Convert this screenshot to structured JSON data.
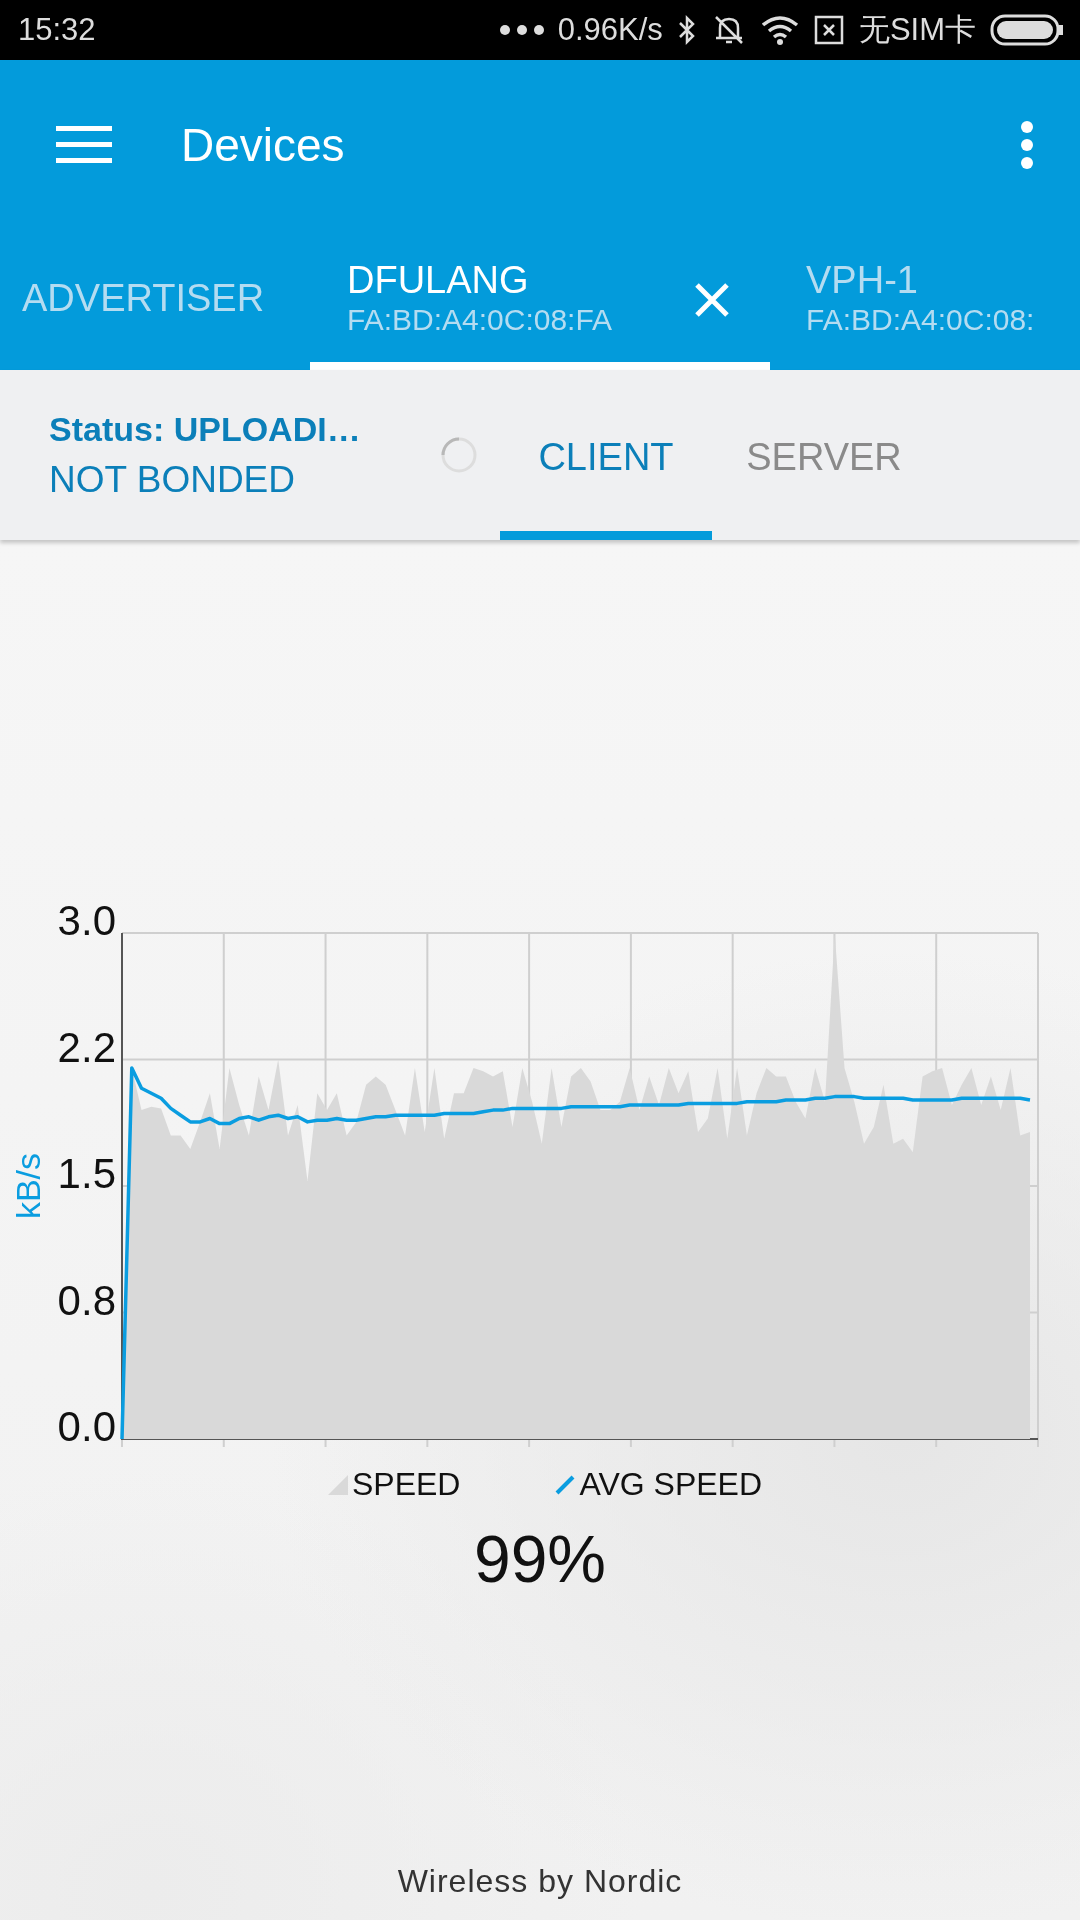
{
  "status_bar": {
    "time": "15:32",
    "network_speed": "0.96K/s",
    "sim_status": "无SIM卡"
  },
  "toolbar": {
    "title": "Devices"
  },
  "device_tabs": [
    {
      "label": "ADVERTISER",
      "selected": false
    },
    {
      "label": "DFULANG",
      "address": "FA:BD:A4:0C:08:FA",
      "selected": true
    },
    {
      "label": "VPH-1",
      "address": "FA:BD:A4:0C:08:",
      "selected": false
    }
  ],
  "connection": {
    "status": "Status: UPLOADI…",
    "bond": "NOT BONDED"
  },
  "role_tabs": [
    {
      "label": "CLIENT",
      "selected": true
    },
    {
      "label": "SERVER",
      "selected": false
    }
  ],
  "chart_data": {
    "type": "area",
    "grid": true,
    "ylabel": "kB/s",
    "ylim": [
      0,
      3
    ],
    "yticks": [
      {
        "value": 0,
        "label": "0.0"
      },
      {
        "value": 0.75,
        "label": "0.8"
      },
      {
        "value": 1.5,
        "label": "1.5"
      },
      {
        "value": 2.25,
        "label": "2.2"
      },
      {
        "value": 3,
        "label": "3.0"
      }
    ],
    "series": [
      {
        "name": "SPEED",
        "type": "area",
        "color": "#d9d9d9",
        "values": [
          0,
          2.2,
          1.95,
          1.97,
          1.96,
          1.8,
          1.8,
          1.72,
          1.88,
          2.05,
          1.72,
          2.2,
          1.98,
          1.8,
          2.15,
          1.95,
          2.25,
          1.8,
          1.98,
          1.53,
          2.05,
          1.95,
          2.05,
          1.8,
          1.88,
          2.1,
          2.15,
          2.1,
          1.95,
          1.8,
          2.2,
          1.82,
          2.2,
          1.78,
          2.05,
          2.05,
          2.2,
          2.18,
          2.15,
          2.18,
          1.85,
          2.2,
          2.0,
          1.75,
          2.2,
          1.85,
          2.15,
          2.2,
          2.12,
          1.95,
          1.95,
          2.0,
          2.2,
          1.95,
          2.15,
          1.98,
          2.2,
          2.05,
          2.18,
          1.82,
          1.9,
          2.2,
          1.78,
          2.2,
          1.8,
          2.05,
          2.2,
          2.15,
          2.15,
          2.0,
          1.9,
          2.2,
          2.0,
          3.0,
          2.2,
          2.0,
          1.75,
          1.85,
          2.1,
          1.75,
          1.78,
          1.7,
          2.15,
          2.18,
          2.2,
          1.98,
          2.1,
          2.2,
          1.98,
          2.15,
          1.95,
          2.2,
          1.8,
          1.82
        ]
      },
      {
        "name": "AVG SPEED",
        "type": "line",
        "color": "#0a9de0",
        "values": [
          0,
          2.2,
          2.08,
          2.05,
          2.02,
          1.96,
          1.92,
          1.88,
          1.88,
          1.9,
          1.87,
          1.87,
          1.9,
          1.91,
          1.89,
          1.91,
          1.92,
          1.9,
          1.91,
          1.88,
          1.89,
          1.89,
          1.9,
          1.89,
          1.89,
          1.9,
          1.91,
          1.91,
          1.92,
          1.92,
          1.92,
          1.92,
          1.92,
          1.93,
          1.93,
          1.93,
          1.93,
          1.94,
          1.95,
          1.95,
          1.96,
          1.96,
          1.96,
          1.96,
          1.96,
          1.96,
          1.97,
          1.97,
          1.97,
          1.97,
          1.97,
          1.97,
          1.98,
          1.98,
          1.98,
          1.98,
          1.98,
          1.98,
          1.99,
          1.99,
          1.99,
          1.99,
          1.99,
          1.99,
          2.0,
          2.0,
          2.0,
          2.0,
          2.01,
          2.01,
          2.01,
          2.02,
          2.02,
          2.03,
          2.03,
          2.03,
          2.02,
          2.02,
          2.02,
          2.02,
          2.02,
          2.01,
          2.01,
          2.01,
          2.01,
          2.01,
          2.02,
          2.02,
          2.02,
          2.02,
          2.02,
          2.02,
          2.02,
          2.01
        ]
      }
    ]
  },
  "progress": "99%",
  "footer": "Wireless by Nordic"
}
